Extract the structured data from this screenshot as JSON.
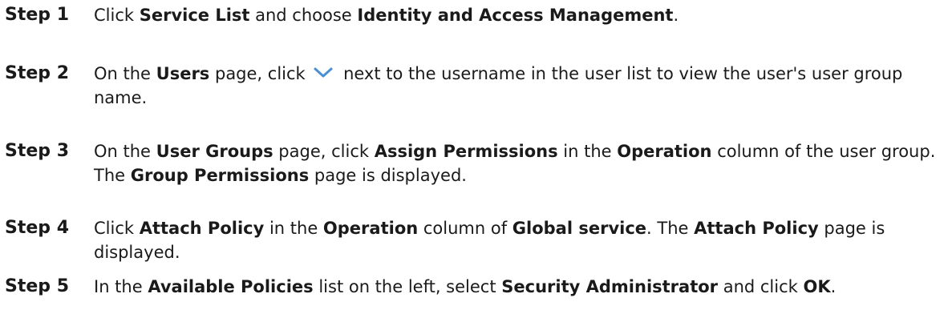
{
  "steps": [
    {
      "label": "Step 1",
      "parts": [
        {
          "t": "Click "
        },
        {
          "b": "Service List"
        },
        {
          "t": " and choose "
        },
        {
          "b": "Identity and Access Management"
        },
        {
          "t": "."
        }
      ]
    },
    {
      "label": "Step 2",
      "parts": [
        {
          "t": "On the "
        },
        {
          "b": "Users"
        },
        {
          "t": " page, click "
        },
        {
          "icon": "chevron-down-icon"
        },
        {
          "t": " next to the username in the user list to view the user's user group name."
        }
      ]
    },
    {
      "label": "Step 3",
      "parts": [
        {
          "t": "On the "
        },
        {
          "b": "User Groups"
        },
        {
          "t": " page, click "
        },
        {
          "b": "Assign Permissions"
        },
        {
          "t": " in the "
        },
        {
          "b": "Operation"
        },
        {
          "t": " column of the user group. The "
        },
        {
          "b": "Group Permissions"
        },
        {
          "t": " page is displayed."
        }
      ]
    },
    {
      "label": "Step 4",
      "parts": [
        {
          "t": "Click "
        },
        {
          "b": "Attach Policy"
        },
        {
          "t": " in the "
        },
        {
          "b": "Operation"
        },
        {
          "t": " column of "
        },
        {
          "b": "Global service"
        },
        {
          "t": ". The "
        },
        {
          "b": "Attach Policy"
        },
        {
          "t": " page is displayed."
        }
      ]
    },
    {
      "label": "Step 5",
      "parts": [
        {
          "t": "In the "
        },
        {
          "b": "Available Policies"
        },
        {
          "t": " list on the left, select "
        },
        {
          "b": "Security Administrator"
        },
        {
          "t": " and click "
        },
        {
          "b": "OK"
        },
        {
          "t": "."
        }
      ]
    }
  ],
  "colors": {
    "text": "#1a1a1a",
    "chevron": "#4a8fd4"
  }
}
